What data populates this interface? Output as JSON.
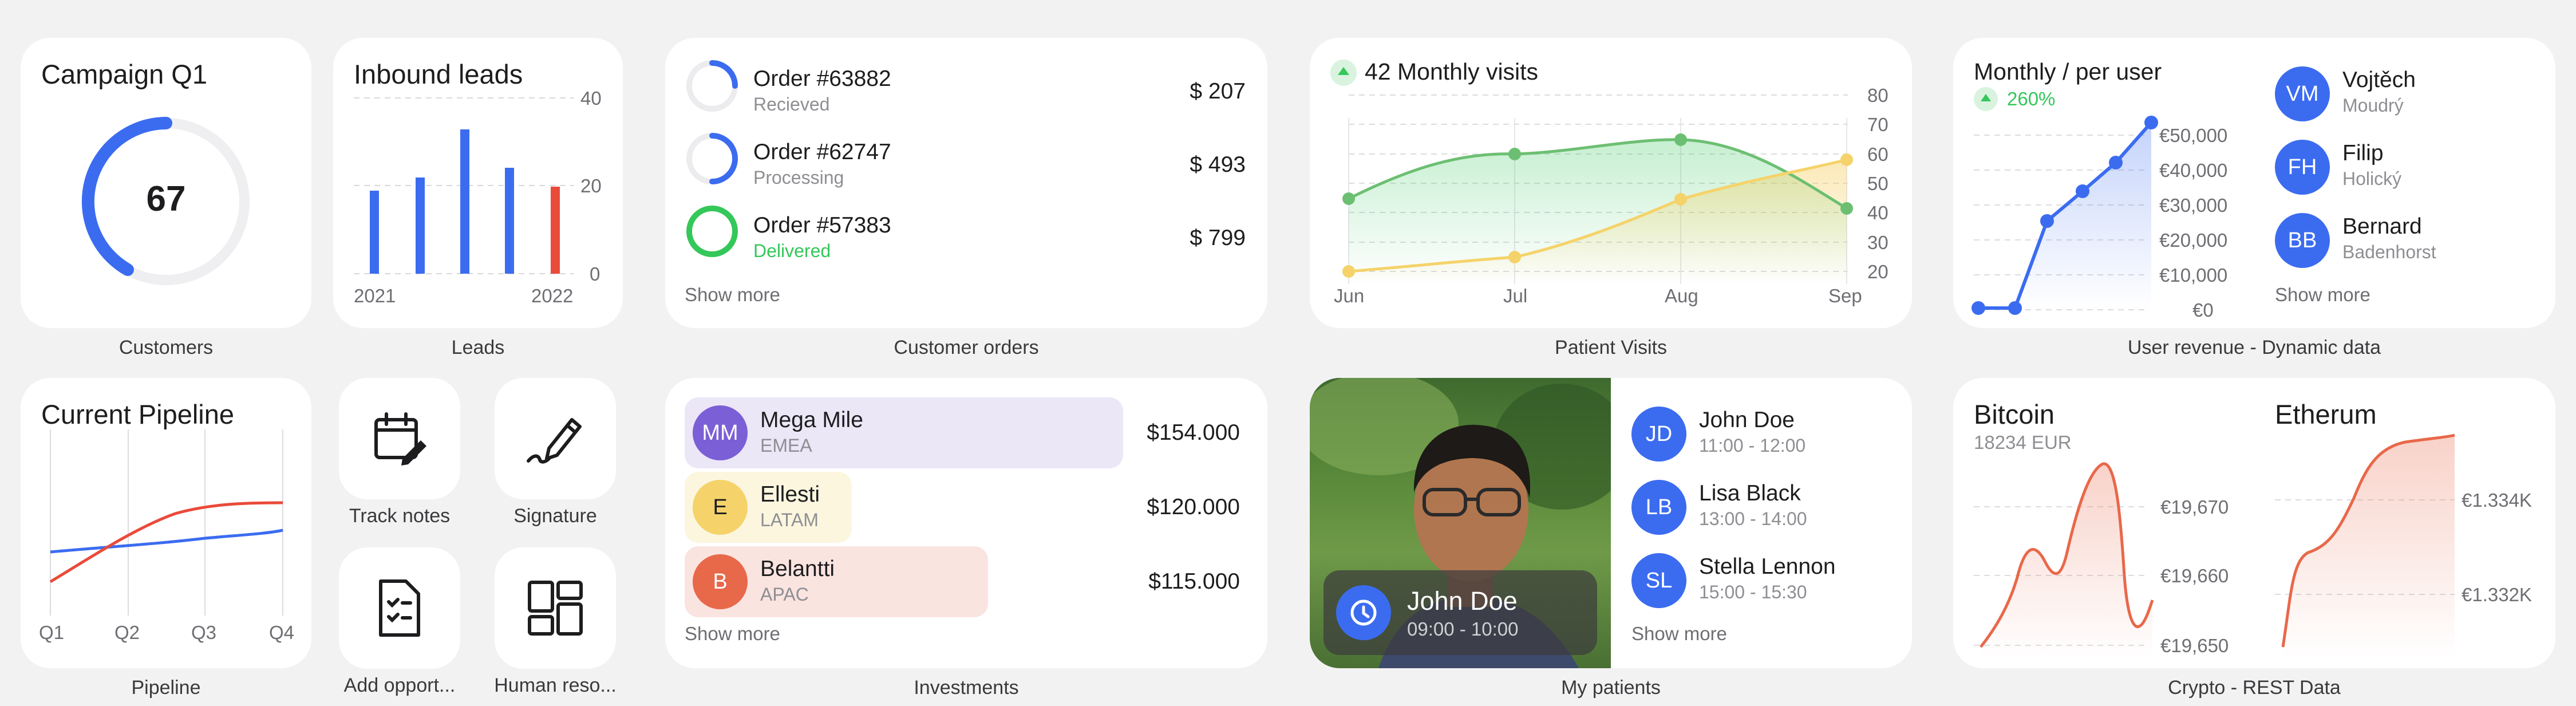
{
  "colors": {
    "blue": "#3b6cf0",
    "red": "#ea4a3a",
    "green": "#34c759",
    "yellow": "#f5c84a",
    "purple": "#7b5fd6"
  },
  "campaign": {
    "title": "Campaign Q1",
    "value": "67",
    "percent": 67,
    "caption": "Customers"
  },
  "leads": {
    "title": "Inbound leads",
    "caption": "Leads",
    "xlabels": [
      "2021",
      "2022"
    ],
    "yticks": [
      "40",
      "20",
      "0"
    ]
  },
  "orders": {
    "caption": "Customer orders",
    "items": [
      {
        "name": "Order #63882",
        "status": "Recieved",
        "price": "$ 207",
        "progress": 0.25
      },
      {
        "name": "Order #62747",
        "status": "Processing",
        "price": "$ 493",
        "progress": 0.5
      },
      {
        "name": "Order #57383",
        "status": "Delivered",
        "price": "$ 799",
        "progress": 1.0
      }
    ],
    "show_more": "Show more"
  },
  "visits": {
    "title": "42 Monthly visits",
    "caption": "Patient Visits",
    "xlabels": [
      "Jun",
      "Jul",
      "Aug",
      "Sep"
    ],
    "yticks": [
      "80",
      "70",
      "60",
      "50",
      "40",
      "30",
      "20"
    ]
  },
  "revenue": {
    "title": "Monthly / per user",
    "change": "260%",
    "caption": "User revenue - Dynamic data",
    "yticks": [
      "€50,000",
      "€40,000",
      "€30,000",
      "€20,000",
      "€10,000",
      "€0"
    ],
    "users": [
      {
        "initials": "VM",
        "first": "Vojtěch",
        "last": "Moudrý"
      },
      {
        "initials": "FH",
        "first": "Filip",
        "last": "Holický"
      },
      {
        "initials": "BB",
        "first": "Bernard",
        "last": "Badenhorst"
      }
    ],
    "show_more": "Show more"
  },
  "pipeline": {
    "title": "Current Pipeline",
    "caption": "Pipeline",
    "xlabels": [
      "Q1",
      "Q2",
      "Q3",
      "Q4"
    ]
  },
  "tiles": [
    {
      "label": "Track notes",
      "icon": "calendar-edit-icon"
    },
    {
      "label": "Signature",
      "icon": "pen-signature-icon"
    },
    {
      "label": "Add opport...",
      "icon": "checklist-icon"
    },
    {
      "label": "Human reso...",
      "icon": "dashboard-layout-icon"
    }
  ],
  "investments": {
    "caption": "Investments",
    "items": [
      {
        "initials": "MM",
        "name": "Mega Mile",
        "region": "EMEA",
        "amount": "$154.000",
        "share": 1.0
      },
      {
        "initials": "E",
        "name": "Ellesti",
        "region": "LATAM",
        "amount": "$120.000",
        "share": 0.37
      },
      {
        "initials": "B",
        "name": "Belantti",
        "region": "APAC",
        "amount": "$115.000",
        "share": 0.67
      }
    ],
    "show_more": "Show more"
  },
  "patients": {
    "caption": "My patients",
    "featured": {
      "name": "John Doe",
      "time": "09:00 - 10:00"
    },
    "items": [
      {
        "initials": "JD",
        "name": "John Doe",
        "time": "11:00 - 12:00"
      },
      {
        "initials": "LB",
        "name": "Lisa Black",
        "time": "13:00 - 14:00"
      },
      {
        "initials": "SL",
        "name": "Stella Lennon",
        "time": "15:00 - 15:30"
      }
    ],
    "show_more": "Show more"
  },
  "crypto": {
    "caption": "Crypto - REST Data",
    "bitcoin": {
      "title": "Bitcoin",
      "sub": "18234 EUR",
      "yticks": [
        "€19,670",
        "€19,660",
        "€19,650"
      ]
    },
    "ether": {
      "title": "Etherum",
      "yticks": [
        "€1.334K",
        "€1.332K"
      ]
    }
  }
}
